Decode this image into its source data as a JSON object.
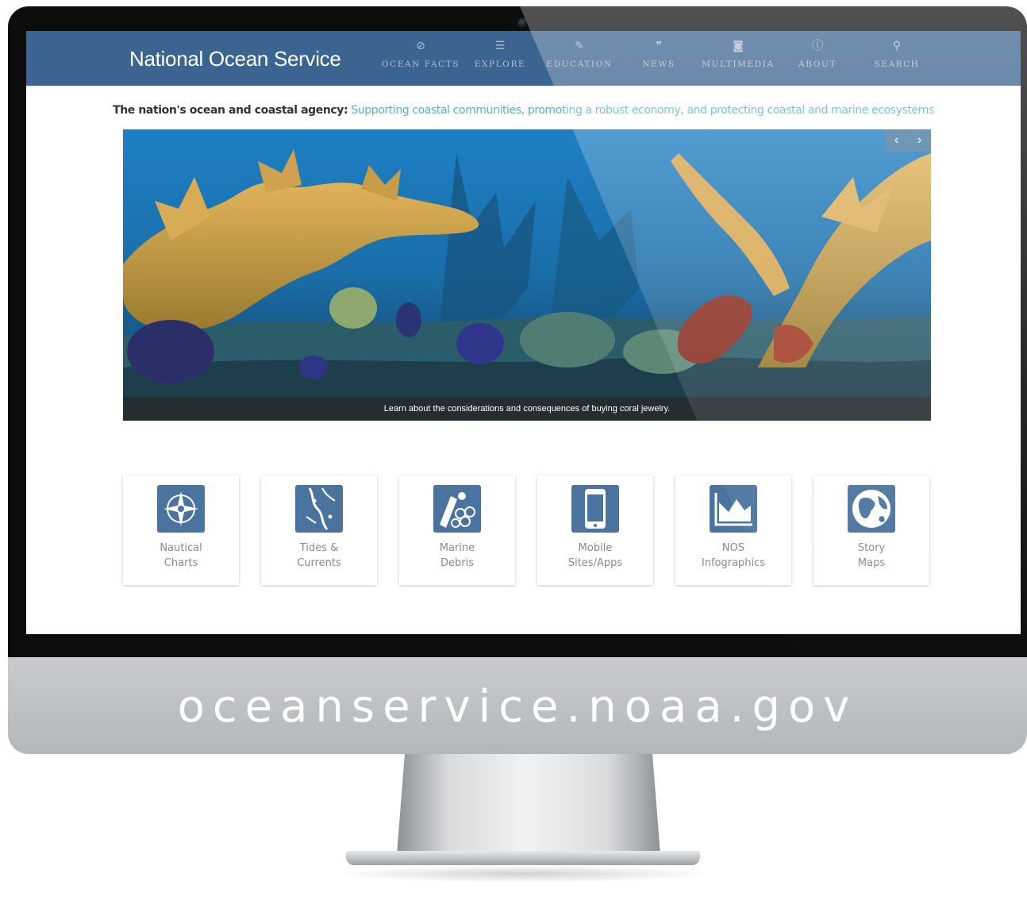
{
  "site": {
    "title": "National Ocean Service"
  },
  "nav": [
    {
      "label": "OCEAN FACTS",
      "icon": "compass-icon"
    },
    {
      "label": "EXPLORE",
      "icon": "list-icon"
    },
    {
      "label": "EDUCATION",
      "icon": "pencil-icon"
    },
    {
      "label": "NEWS",
      "icon": "quote-icon"
    },
    {
      "label": "MULTIMEDIA",
      "icon": "camera-icon"
    },
    {
      "label": "ABOUT",
      "icon": "info-icon"
    },
    {
      "label": "SEARCH",
      "icon": "search-icon"
    }
  ],
  "tagline": {
    "lead": "The nation's ocean and coastal agency:",
    "rest": "Supporting coastal communities, promoting a robust economy, and protecting coastal and marine ecosystems"
  },
  "hero": {
    "caption": "Learn about the considerations and consequences of buying coral jewelry.",
    "prev": "‹",
    "next": "›"
  },
  "tiles": [
    {
      "line1": "Nautical",
      "line2": "Charts",
      "icon": "compass-rose-icon"
    },
    {
      "line1": "Tides &",
      "line2": "Currents",
      "icon": "tide-map-icon"
    },
    {
      "line1": "Marine",
      "line2": "Debris",
      "icon": "debris-icon"
    },
    {
      "line1": "Mobile",
      "line2": "Sites/Apps",
      "icon": "mobile-phone-icon"
    },
    {
      "line1": "NOS",
      "line2": "Infographics",
      "icon": "area-chart-icon"
    },
    {
      "line1": "Story",
      "line2": "Maps",
      "icon": "globe-icon"
    }
  ],
  "monitor": {
    "url": "oceanservice.noaa.gov"
  },
  "colors": {
    "navbar": "#3c6490",
    "tile_icon": "#4a739e",
    "tagline_accent": "#5ab0c8",
    "tile_text": "#8a8a8a"
  }
}
